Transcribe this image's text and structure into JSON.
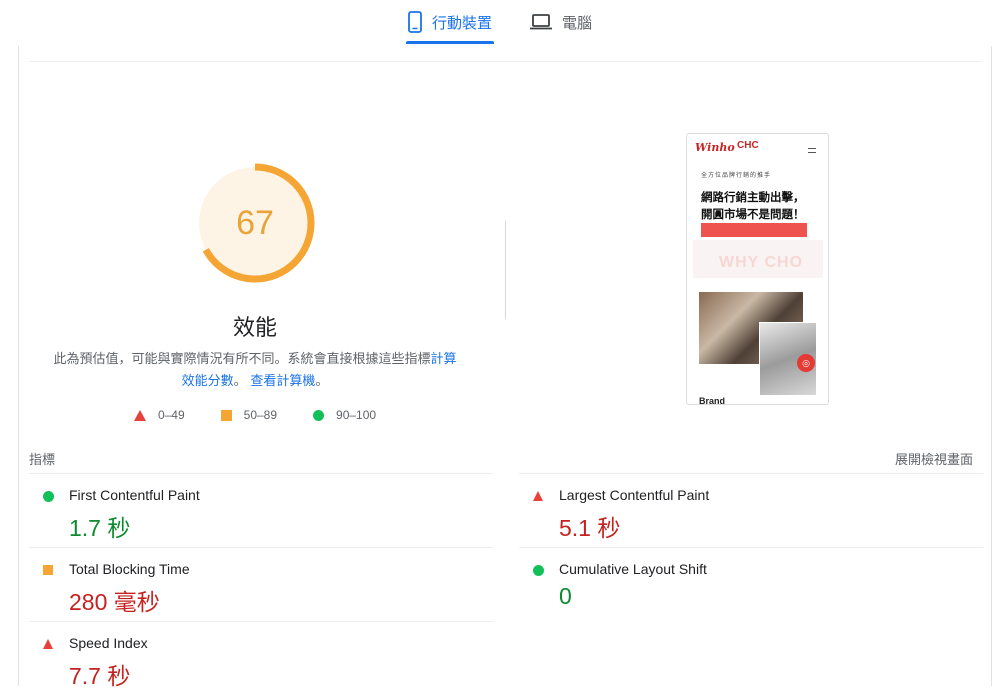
{
  "tabs": [
    {
      "label": "行動裝置",
      "icon": "mobile-icon",
      "active": true
    },
    {
      "label": "電腦",
      "icon": "laptop-icon",
      "active": false
    }
  ],
  "performance": {
    "score": "67",
    "score_fraction": 0.67,
    "title": "效能",
    "description_prefix": "此為預估值，可能與實際情況有所不同。系統會直接根據這些指標",
    "link_calc": "計算效能分數",
    "description_mid": "。",
    "link_calculator": "查看計算機",
    "description_suffix": "。",
    "colors": {
      "score": "#e8a33a",
      "ring": "#f4a533",
      "ring_bg": "#fef4e6"
    }
  },
  "legend": [
    {
      "icon": "fail-triangle-icon",
      "label": "0–49"
    },
    {
      "icon": "average-square-icon",
      "label": "50–89"
    },
    {
      "icon": "pass-circle-icon",
      "label": "90–100"
    }
  ],
  "screenshot": {
    "logo_left": "Winho",
    "logo_right": "CHC",
    "subtitle": "全方位品牌行銷的推手",
    "headline": "網路行銷主動出擊，開圓市場不是問題！",
    "bg_text": "WHY CHO",
    "photo_badge": "◎",
    "brand_text": "Brand"
  },
  "metrics_header": {
    "left": "指標",
    "right": "展開檢視畫面"
  },
  "metrics": [
    {
      "name": "First Contentful Paint",
      "value": "1.7 秒",
      "status": "pass"
    },
    {
      "name": "Largest Contentful Paint",
      "value": "5.1 秒",
      "status": "fail"
    },
    {
      "name": "Total Blocking Time",
      "value": "280 毫秒",
      "status": "average"
    },
    {
      "name": "Cumulative Layout Shift",
      "value": "0",
      "status": "pass"
    },
    {
      "name": "Speed Index",
      "value": "7.7 秒",
      "status": "fail"
    }
  ]
}
